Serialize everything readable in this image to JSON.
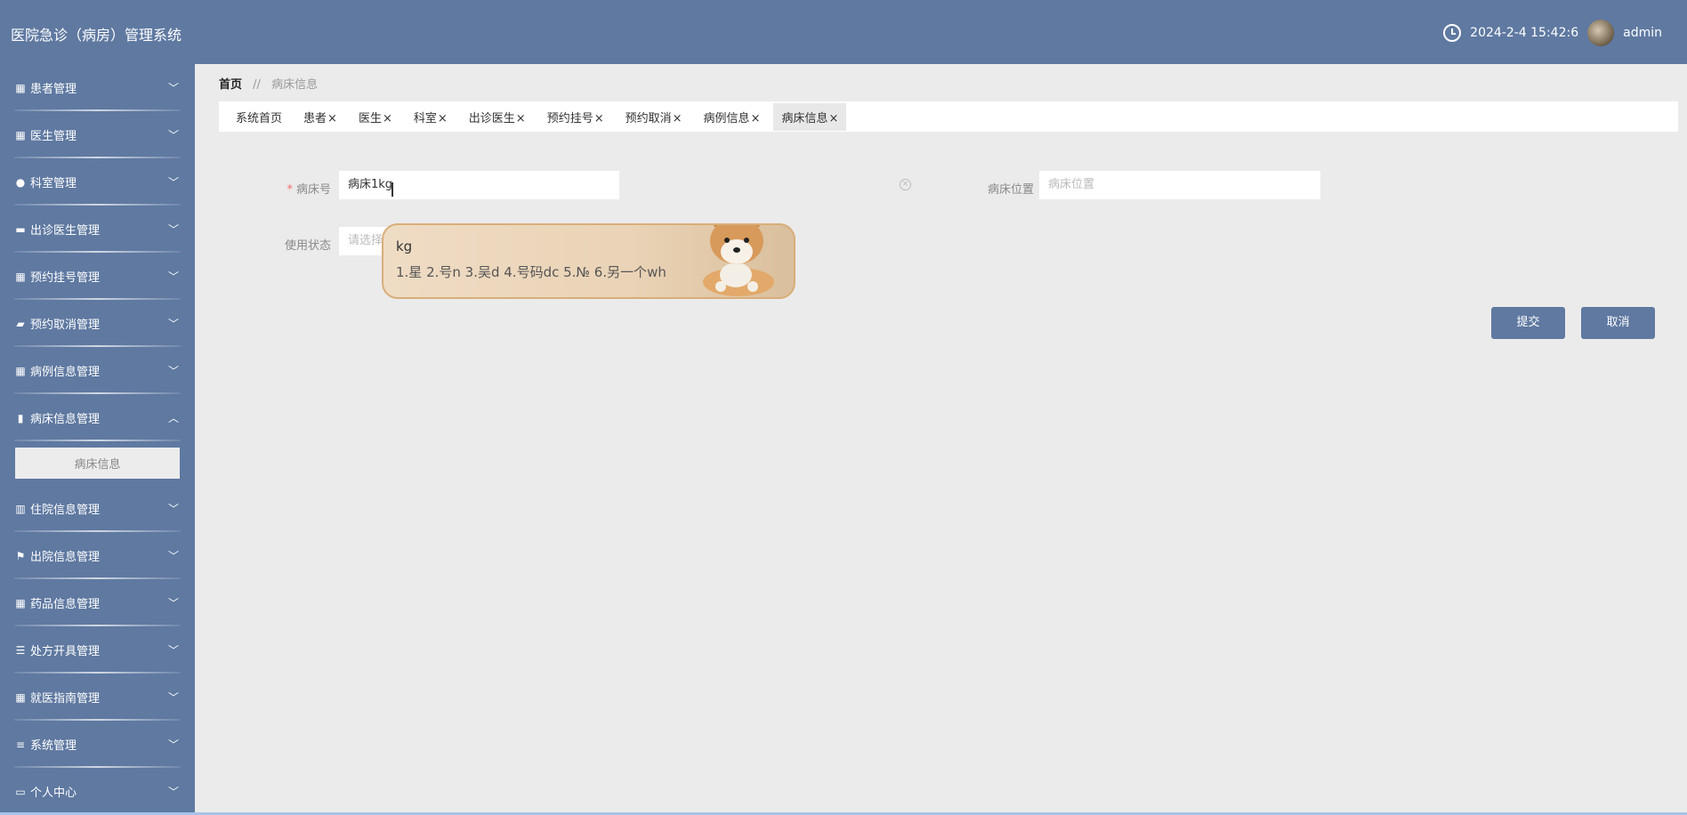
{
  "header": {
    "title": "医院急诊（病房）管理系统",
    "datetime": "2024-2-4 15:42:6",
    "username": "admin"
  },
  "sidebar": {
    "items": [
      {
        "label": "患者管理",
        "icon": "grid-icon"
      },
      {
        "label": "医生管理",
        "icon": "grid-icon"
      },
      {
        "label": "科室管理",
        "icon": "bulb-icon"
      },
      {
        "label": "出诊医生管理",
        "icon": "briefcase-icon"
      },
      {
        "label": "预约挂号管理",
        "icon": "grid-icon"
      },
      {
        "label": "预约取消管理",
        "icon": "chat-icon"
      },
      {
        "label": "病例信息管理",
        "icon": "grid-icon"
      },
      {
        "label": "病床信息管理",
        "icon": "clipboard-icon"
      },
      {
        "label": "住院信息管理",
        "icon": "bar-chart-icon"
      },
      {
        "label": "出院信息管理",
        "icon": "flag-icon"
      },
      {
        "label": "药品信息管理",
        "icon": "grid-icon"
      },
      {
        "label": "处方开具管理",
        "icon": "sliders-icon"
      },
      {
        "label": "就医指南管理",
        "icon": "grid-icon"
      },
      {
        "label": "系统管理",
        "icon": "list-icon"
      },
      {
        "label": "个人中心",
        "icon": "card-icon"
      }
    ],
    "sub_item": "病床信息"
  },
  "breadcrumb": {
    "home": "首页",
    "sep": "//",
    "current": "病床信息"
  },
  "tabs": [
    {
      "label": "系统首页",
      "closable": false
    },
    {
      "label": "患者",
      "closable": true
    },
    {
      "label": "医生",
      "closable": true
    },
    {
      "label": "科室",
      "closable": true
    },
    {
      "label": "出诊医生",
      "closable": true
    },
    {
      "label": "预约挂号",
      "closable": true
    },
    {
      "label": "预约取消",
      "closable": true
    },
    {
      "label": "病例信息",
      "closable": true
    },
    {
      "label": "病床信息",
      "closable": true
    }
  ],
  "form": {
    "bed_no_label": "病床号",
    "bed_no_required": "*",
    "bed_no_value": "病床1kg",
    "bed_location_label": "病床位置",
    "bed_location_placeholder": "病床位置",
    "status_label": "使用状态",
    "status_placeholder": "请选择",
    "submit": "提交",
    "cancel": "取消"
  },
  "ime": {
    "composition": "kg",
    "candidates": "1.星  2.号n  3.吴d  4.号码dc  5.№  6.另一个wh"
  },
  "colors": {
    "primary": "#5f79a1",
    "background": "#ebebeb"
  }
}
